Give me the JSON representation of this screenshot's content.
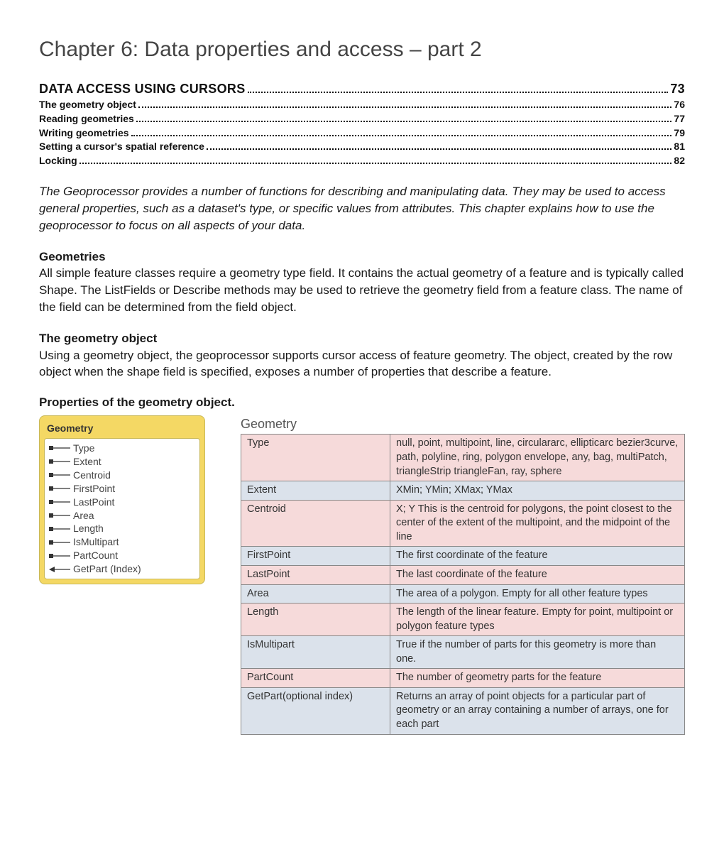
{
  "chapter_title": "Chapter 6: Data properties and access – part 2",
  "toc": [
    {
      "label": "DATA ACCESS USING CURSORS",
      "page": "73",
      "level": "main"
    },
    {
      "label": "The geometry object",
      "page": "76",
      "level": "sub"
    },
    {
      "label": "Reading geometries",
      "page": "77",
      "level": "sub"
    },
    {
      "label": "Writing geometries",
      "page": "79",
      "level": "sub"
    },
    {
      "label": "Setting a cursor's spatial reference",
      "page": "81",
      "level": "sub"
    },
    {
      "label": "Locking",
      "page": "82",
      "level": "sub"
    }
  ],
  "intro": "The Geoprocessor provides a number of functions for describing and manipulating data. They may be used to access general properties, such as a dataset's type, or specific values from attributes. This chapter explains how to use the geoprocessor to focus on all aspects of your data.",
  "section1": {
    "heading": "Geometries",
    "body": "All simple feature classes require a geometry type field. It contains the actual geometry of a feature and is typically called Shape. The ListFields or Describe methods may be used to retrieve the geometry field from a feature class. The name of the field can be determined from the field object."
  },
  "section2": {
    "heading": "The geometry object",
    "body": "Using a geometry object, the geoprocessor supports cursor access of feature geometry. The object, created by the row object when the shape field is specified, exposes a number of properties that describe a feature."
  },
  "props_heading": "Properties of the geometry object.",
  "geom_box": {
    "title": "Geometry",
    "items": [
      {
        "kind": "prop",
        "label": "Type"
      },
      {
        "kind": "prop",
        "label": "Extent"
      },
      {
        "kind": "prop",
        "label": "Centroid"
      },
      {
        "kind": "prop",
        "label": "FirstPoint"
      },
      {
        "kind": "prop",
        "label": "LastPoint"
      },
      {
        "kind": "prop",
        "label": "Area"
      },
      {
        "kind": "prop",
        "label": "Length"
      },
      {
        "kind": "prop",
        "label": "IsMultipart"
      },
      {
        "kind": "prop",
        "label": "PartCount"
      },
      {
        "kind": "method",
        "label": "GetPart (Index)"
      }
    ]
  },
  "geom_table": {
    "title": "Geometry",
    "rows": [
      {
        "name": "Type",
        "desc": "null, point, multipoint, line, circulararc, ellipticarc bezier3curve, path, polyline, ring, polygon envelope, any, bag, multiPatch, triangleStrip triangleFan, ray, sphere",
        "cls": "pink"
      },
      {
        "name": "Extent",
        "desc": "XMin; YMin; XMax; YMax",
        "cls": "blue"
      },
      {
        "name": "Centroid",
        "desc": "X; Y  This is the centroid for polygons, the point closest to the center of the extent of the multipoint, and the midpoint of the line",
        "cls": "pink"
      },
      {
        "name": "FirstPoint",
        "desc": "The first coordinate of the feature",
        "cls": "blue"
      },
      {
        "name": "LastPoint",
        "desc": "The last coordinate of the feature",
        "cls": "pink"
      },
      {
        "name": "Area",
        "desc": "The area of a polygon. Empty for all other feature types",
        "cls": "blue"
      },
      {
        "name": "Length",
        "desc": "The length of the linear feature. Empty for point, multipoint or polygon feature types",
        "cls": "pink"
      },
      {
        "name": "IsMultipart",
        "desc": "True if the number of parts for this geometry is more than one.",
        "cls": "blue"
      },
      {
        "name": "PartCount",
        "desc": "The number of geometry parts for the feature",
        "cls": "pink"
      },
      {
        "name": "GetPart(optional index)",
        "desc": "Returns an array of point objects for a particular part of geometry or an array containing a number of arrays, one for each part",
        "cls": "blue"
      }
    ]
  }
}
